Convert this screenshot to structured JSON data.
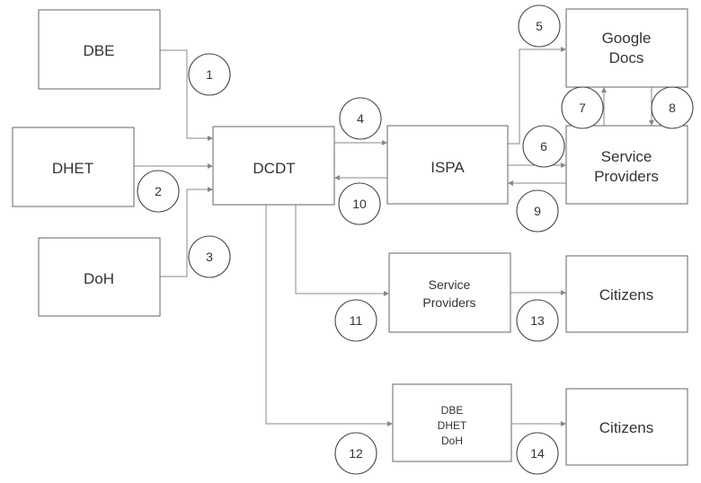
{
  "nodes": {
    "dbe": "DBE",
    "dhet": "DHET",
    "doh": "DoH",
    "dcdt": "DCDT",
    "ispa": "ISPA",
    "google_docs": [
      "Google",
      "Docs"
    ],
    "service_providers_top": [
      "Service",
      "Providers"
    ],
    "service_providers_mid": [
      "Service",
      "Providers"
    ],
    "citizens_mid": "Citizens",
    "departments_group": [
      "DBE",
      "DHET",
      "DoH"
    ],
    "citizens_bottom": "Citizens"
  },
  "steps": [
    "1",
    "2",
    "3",
    "4",
    "5",
    "6",
    "7",
    "8",
    "9",
    "10",
    "11",
    "12",
    "13",
    "14"
  ]
}
